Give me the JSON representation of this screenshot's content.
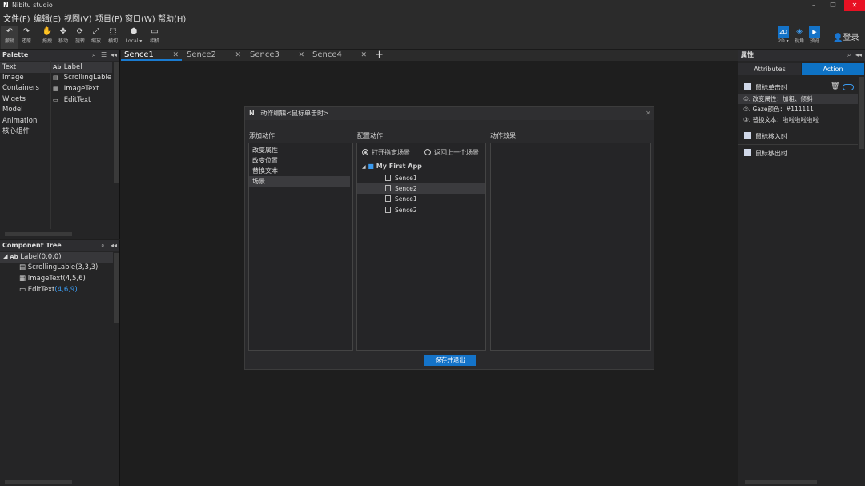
{
  "app": {
    "logo": "N",
    "title": "Nibitu studio"
  },
  "window_controls": {
    "minimize": "–",
    "restore": "❐",
    "close": "✕"
  },
  "menu": [
    "文件(F)",
    "编辑(E)",
    "视图(V)",
    "项目(P)",
    "窗口(W)",
    "帮助(H)"
  ],
  "toolbar": {
    "tools": [
      {
        "icon": "undo-icon",
        "glyph": "↶",
        "label": "撤销"
      },
      {
        "icon": "redo-icon",
        "glyph": "↷",
        "label": "还原"
      },
      {
        "icon": "hand-icon",
        "glyph": "✋",
        "label": "拖拽"
      },
      {
        "icon": "move-icon",
        "glyph": "✥",
        "label": "移动"
      },
      {
        "icon": "rotate-icon",
        "glyph": "⟳",
        "label": "旋转"
      },
      {
        "icon": "scale-icon",
        "glyph": "⤢",
        "label": "缩放"
      },
      {
        "icon": "rect-icon",
        "glyph": "⬚",
        "label": "横切"
      },
      {
        "icon": "local-icon",
        "glyph": "⬢",
        "label": "Local ▾"
      },
      {
        "icon": "camera-icon",
        "glyph": "▭",
        "label": "相机"
      }
    ],
    "right": [
      {
        "icon": "2d-icon",
        "glyph": "2D",
        "label": "2D ▾"
      },
      {
        "icon": "view-icon",
        "glyph": "◈",
        "label": "视角"
      },
      {
        "icon": "preview-icon",
        "glyph": "▶",
        "label": "预览"
      }
    ],
    "login_label": "登录"
  },
  "palette": {
    "title": "Palette",
    "categories": [
      "Text",
      "Image",
      "Containers",
      "Wigets",
      "Model",
      "Animation",
      "核心组件"
    ],
    "items": [
      {
        "icon": "Ab",
        "label": "Label"
      },
      {
        "icon": "▤",
        "label": "ScrollingLable"
      },
      {
        "icon": "▦",
        "label": "ImageText"
      },
      {
        "icon": "▭",
        "label": "EditText"
      }
    ]
  },
  "component_tree": {
    "title": "Component Tree",
    "root": {
      "icon": "Ab",
      "label": "Label(0,0,0)"
    },
    "children": [
      {
        "icon": "▤",
        "label": "ScrollingLable(3,3,3)",
        "extra": ""
      },
      {
        "icon": "▦",
        "label": "ImageText(4,5,6)",
        "extra": ""
      },
      {
        "icon": "▭",
        "label": "EditText",
        "extra": "(4,6,9)"
      }
    ]
  },
  "tabs": [
    {
      "label": "Sence1",
      "close": "✕"
    },
    {
      "label": "Sence2",
      "close": "✕"
    },
    {
      "label": "Sence3",
      "close": "✕"
    },
    {
      "label": "Sence4",
      "close": "✕"
    }
  ],
  "add_tab": "+",
  "dialog": {
    "title": "动作编辑<鼠标单击时>",
    "close": "✕",
    "col_add": "添加动作",
    "col_config": "配置动作",
    "col_effect": "动作效果",
    "actions": [
      "改变属性",
      "改变位置",
      "替换文本",
      "场景"
    ],
    "radio_open": "打开指定场景",
    "radio_back": "返回上一个场景",
    "app_name": "My First App",
    "scenes": [
      "Sence1",
      "Sence2",
      "Sence1",
      "Sence2"
    ],
    "save_label": "保存并退出"
  },
  "props": {
    "title": "属性",
    "tab_attributes": "Attributes",
    "tab_action": "Action",
    "event_click": "鼠标单击时",
    "action_lines": [
      "①. 改变属性：加粗、倾斜",
      "②. Gaze颜色：#111111",
      "③. 替换文本：啦啦啦啦啦啦"
    ],
    "event_enter": "鼠标移入时",
    "event_leave": "鼠标移出时"
  },
  "colors": {
    "accent": "#1473c8",
    "bg": "#1e1e1e",
    "panel": "#252526"
  }
}
